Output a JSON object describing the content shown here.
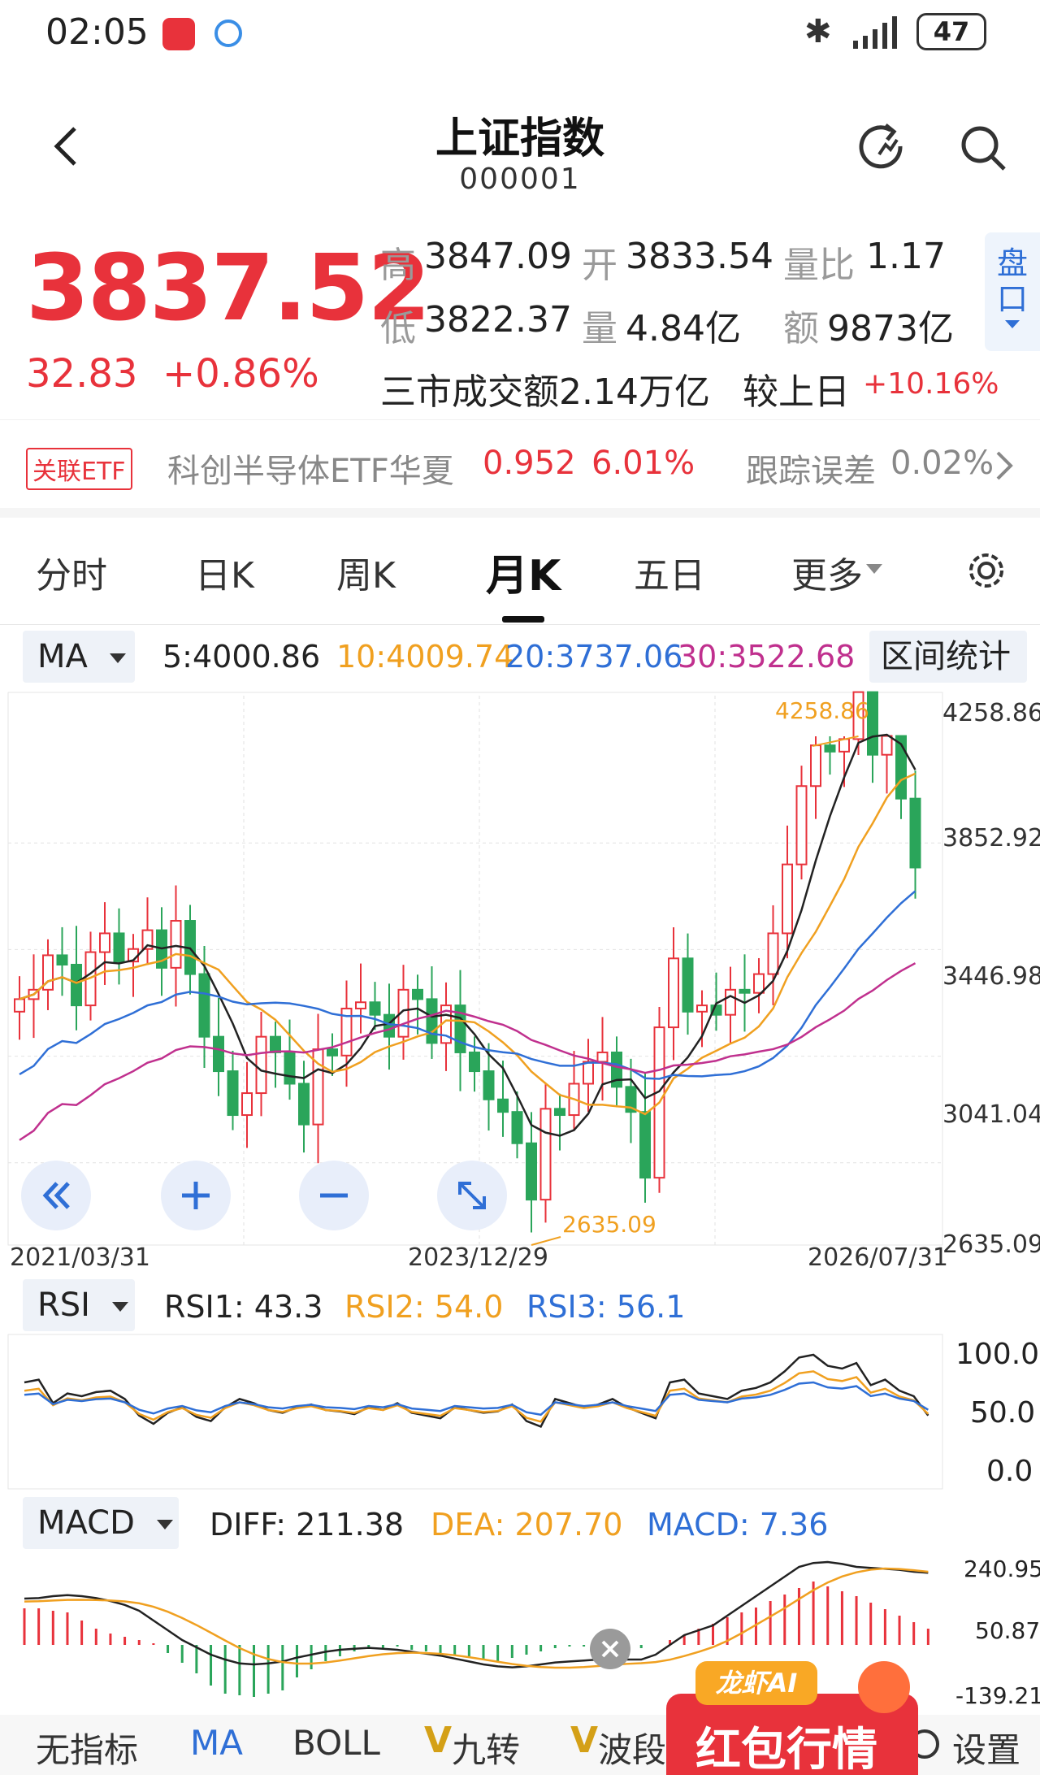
{
  "status_bar": {
    "time": "02:05",
    "battery": "47"
  },
  "header": {
    "title": "上证指数",
    "code": "000001"
  },
  "quote": {
    "price": "3837.52",
    "change": "32.83",
    "change_pct": "+0.86%",
    "high_label": "高",
    "high": "3847.09",
    "open_label": "开",
    "open": "3833.54",
    "vol_ratio_label": "量比",
    "vol_ratio": "1.17",
    "low_label": "低",
    "low": "3822.37",
    "volume_label": "量",
    "volume": "4.84亿",
    "amount_label": "额",
    "amount": "9873亿",
    "turnover_text": "三市成交额2.14万亿",
    "compare_label": "较上日",
    "compare_value": "+10.16%",
    "panko_label": "盘口"
  },
  "etf": {
    "tag": "关联ETF",
    "name": "科创半导体ETF华夏",
    "price": "0.952",
    "pct": "6.01%",
    "tracking_label": "跟踪误差",
    "tracking_value": "0.02%"
  },
  "tabs": [
    "分时",
    "日K",
    "周K",
    "月K",
    "五日",
    "更多"
  ],
  "active_tab": "月K",
  "ma": {
    "selector": "MA",
    "ma5": "5:4000.86",
    "ma10": "10:4009.74",
    "ma20": "20:3737.06",
    "ma30": "30:3522.68",
    "range_stats": "区间统计"
  },
  "kchart": {
    "y_labels": [
      "4258.86",
      "3852.92",
      "3446.98",
      "3041.04",
      "2635.09"
    ],
    "x_labels": [
      "2021/03/31",
      "2023/12/29",
      "2026/07/31"
    ],
    "high_marker": "4258.86",
    "low_marker": "2635.09"
  },
  "rsi": {
    "selector": "RSI",
    "rsi1": "RSI1: 43.3",
    "rsi2": "RSI2: 54.0",
    "rsi3": "RSI3: 56.1",
    "y_labels": [
      "100.0",
      "50.0",
      "0.0"
    ]
  },
  "macd": {
    "selector": "MACD",
    "diff": "DIFF: 211.38",
    "dea": "DEA: 207.70",
    "macd": "MACD: 7.36",
    "y_labels": [
      "240.95",
      "50.87",
      "-139.21"
    ]
  },
  "promo": {
    "brand": "龙虾AI",
    "text": "红包行情"
  },
  "bottom_nav": [
    "无指标",
    "MA",
    "BOLL",
    "九转",
    "波段",
    "设置"
  ],
  "colors": {
    "up": "#e8323b",
    "down": "#2aa55a",
    "ma5": "#222222",
    "ma10": "#f0a020",
    "ma20": "#2f6fd6",
    "ma30": "#c0308e"
  }
}
